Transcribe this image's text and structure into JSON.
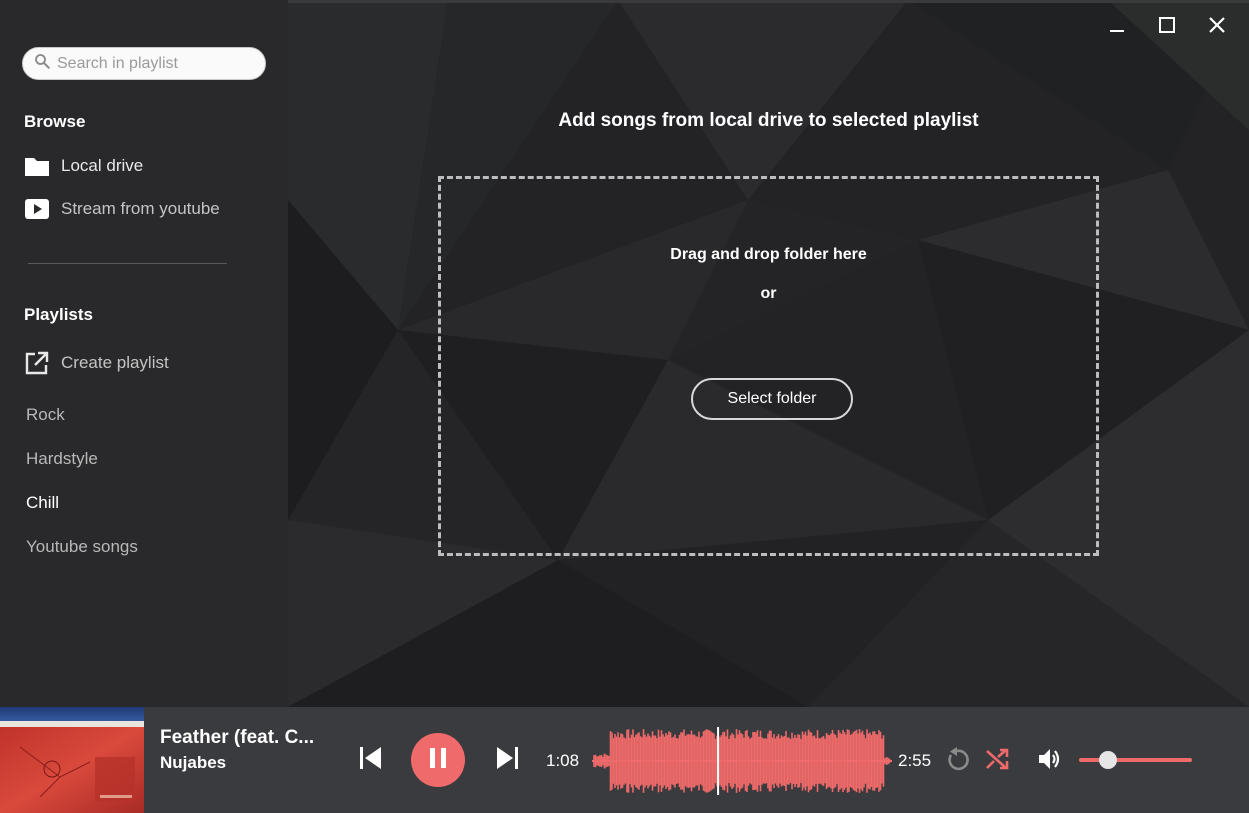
{
  "search": {
    "placeholder": "Search in playlist"
  },
  "browse": {
    "title": "Browse",
    "items": [
      {
        "label": "Local drive",
        "icon": "folder-icon"
      },
      {
        "label": "Stream from youtube",
        "icon": "youtube-play-icon"
      }
    ]
  },
  "playlists": {
    "title": "Playlists",
    "create_label": "Create playlist",
    "create_icon": "open-in-new-icon",
    "items": [
      {
        "label": "Rock",
        "active": false
      },
      {
        "label": "Hardstyle",
        "active": false
      },
      {
        "label": "Chill",
        "active": true
      },
      {
        "label": "Youtube songs",
        "active": false
      }
    ]
  },
  "main": {
    "title": "Add songs from local drive to selected playlist",
    "dropzone": {
      "text": "Drag and drop folder here",
      "or": "or",
      "button": "Select folder"
    }
  },
  "window": {
    "icons": [
      "minimize-icon",
      "maximize-icon",
      "close-icon"
    ]
  },
  "player": {
    "title": "Feather (feat. C...",
    "artist": "Nujabes",
    "elapsed": "1:08",
    "duration": "2:55",
    "progress": 0.39,
    "volume": 0.27,
    "accent": "#ef6a6a",
    "icons": [
      "skip-previous-icon",
      "pause-icon",
      "skip-next-icon",
      "replay-icon",
      "shuffle-icon",
      "volume-icon"
    ]
  }
}
